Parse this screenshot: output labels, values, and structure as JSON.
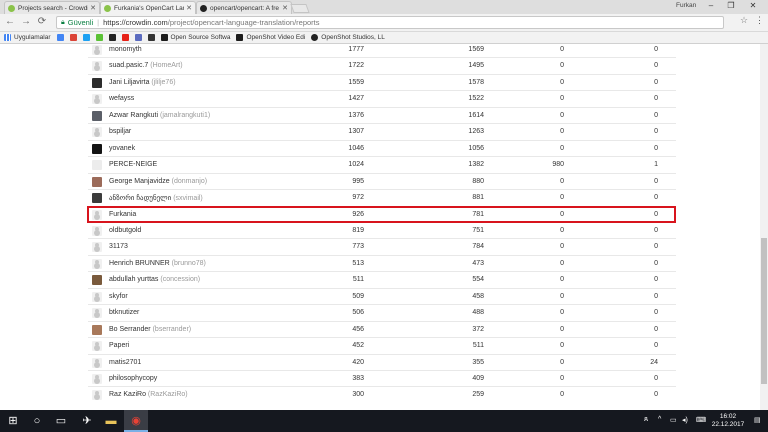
{
  "browser": {
    "tabs": [
      {
        "title": "Projects search - Crowdin",
        "active": false,
        "icon_color": "#8bc34a"
      },
      {
        "title": "Furkania's OpenCart Lan",
        "active": true,
        "icon_color": "#8bc34a"
      },
      {
        "title": "opencart/opencart: A fre",
        "active": false,
        "icon_color": "#222222"
      }
    ],
    "user_name": "Furkan",
    "window_controls": [
      "–",
      "❐",
      "✕"
    ],
    "address": {
      "secure_label": "Güvenli",
      "host": "https://crowdin.com",
      "path": "/project/opencart-language-translation/reports"
    },
    "bookmarks": {
      "apps_label": "Uygulamalar",
      "items": [
        {
          "label": "Open Source Softwa",
          "color": "#1b1b1b"
        },
        {
          "label": "OpenShot Video Edi",
          "color": "#1b1b1b"
        },
        {
          "label": "OpenShot Studios, LL",
          "color": "#222222"
        }
      ]
    }
  },
  "report": {
    "rows": [
      {
        "name": "monomyth",
        "username": "",
        "c1": "1777",
        "c2": "1569",
        "c3": "0",
        "c4": "0",
        "avatar": "default"
      },
      {
        "name": "suad.pasic.7",
        "username": "(HomeArt)",
        "c1": "1722",
        "c2": "1495",
        "c3": "0",
        "c4": "0",
        "avatar": "default"
      },
      {
        "name": "Jani Liljavirta",
        "username": "(jlilje76)",
        "c1": "1559",
        "c2": "1578",
        "c3": "0",
        "c4": "0",
        "avatar": "#2d2d2d"
      },
      {
        "name": "wefayss",
        "username": "",
        "c1": "1427",
        "c2": "1522",
        "c3": "0",
        "c4": "0",
        "avatar": "default"
      },
      {
        "name": "Azwar Rangkuti",
        "username": "(jamalrangkuti1)",
        "c1": "1376",
        "c2": "1614",
        "c3": "0",
        "c4": "0",
        "avatar": "#5b5f68"
      },
      {
        "name": "bspiljar",
        "username": "",
        "c1": "1307",
        "c2": "1263",
        "c3": "0",
        "c4": "0",
        "avatar": "default"
      },
      {
        "name": "yovanek",
        "username": "",
        "c1": "1046",
        "c2": "1056",
        "c3": "0",
        "c4": "0",
        "avatar": "#141414"
      },
      {
        "name": "PERCE-NEIGE",
        "username": "",
        "c1": "1024",
        "c2": "1382",
        "c3": "980",
        "c4": "1",
        "avatar": "#ececec"
      },
      {
        "name": "George Manjavidze",
        "username": "(donmanjo)",
        "c1": "995",
        "c2": "880",
        "c3": "0",
        "c4": "0",
        "avatar": "#9c6b5a"
      },
      {
        "name": "ანზორი ჩადუნელი",
        "username": "(sxvimail)",
        "c1": "972",
        "c2": "881",
        "c3": "0",
        "c4": "0",
        "avatar": "#3c3c3c"
      },
      {
        "name": "Furkania",
        "username": "",
        "c1": "926",
        "c2": "781",
        "c3": "0",
        "c4": "0",
        "avatar": "default"
      },
      {
        "name": "oldbutgold",
        "username": "",
        "c1": "819",
        "c2": "751",
        "c3": "0",
        "c4": "0",
        "avatar": "default"
      },
      {
        "name": "31173",
        "username": "",
        "c1": "773",
        "c2": "784",
        "c3": "0",
        "c4": "0",
        "avatar": "default"
      },
      {
        "name": "Henrich BRUNNER",
        "username": "(brunno78)",
        "c1": "513",
        "c2": "473",
        "c3": "0",
        "c4": "0",
        "avatar": "default"
      },
      {
        "name": "abdullah yurttas",
        "username": "(concession)",
        "c1": "511",
        "c2": "554",
        "c3": "0",
        "c4": "0",
        "avatar": "#7a5a3c"
      },
      {
        "name": "skyfor",
        "username": "",
        "c1": "509",
        "c2": "458",
        "c3": "0",
        "c4": "0",
        "avatar": "default"
      },
      {
        "name": "btknutizer",
        "username": "",
        "c1": "506",
        "c2": "488",
        "c3": "0",
        "c4": "0",
        "avatar": "default"
      },
      {
        "name": "Bo Serrander",
        "username": "(bserrander)",
        "c1": "456",
        "c2": "372",
        "c3": "0",
        "c4": "0",
        "avatar": "#a8785a"
      },
      {
        "name": "Paperi",
        "username": "",
        "c1": "452",
        "c2": "511",
        "c3": "0",
        "c4": "0",
        "avatar": "default"
      },
      {
        "name": "matis2701",
        "username": "",
        "c1": "420",
        "c2": "355",
        "c3": "0",
        "c4": "24",
        "avatar": "default"
      },
      {
        "name": "philosophycopy",
        "username": "",
        "c1": "383",
        "c2": "409",
        "c3": "0",
        "c4": "0",
        "avatar": "default"
      },
      {
        "name": "Raz KaziRo",
        "username": "(RazKaziRo)",
        "c1": "300",
        "c2": "259",
        "c3": "0",
        "c4": "0",
        "avatar": "default"
      }
    ],
    "highlight_color": "#d8141d"
  },
  "taskbar": {
    "time": "16:02",
    "date": "22.12.2017"
  }
}
